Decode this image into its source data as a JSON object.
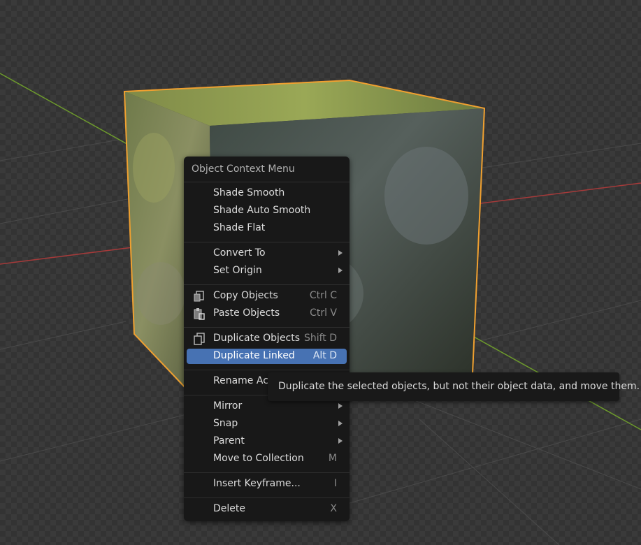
{
  "colors": {
    "menu_bg": "#181818",
    "highlight": "#4772b3",
    "selection_outline": "#f0a030",
    "x_axis": "#b33a3a",
    "y_axis": "#6d9a2c"
  },
  "context_menu": {
    "title": "Object Context Menu",
    "items": [
      {
        "label": "Shade Smooth",
        "shortcut": ""
      },
      {
        "label": "Shade Auto Smooth",
        "shortcut": ""
      },
      {
        "label": "Shade Flat",
        "shortcut": ""
      },
      {
        "label": "Convert To",
        "shortcut": "",
        "submenu": true
      },
      {
        "label": "Set Origin",
        "shortcut": "",
        "submenu": true
      },
      {
        "label": "Copy Objects",
        "shortcut": "Ctrl C",
        "icon": "copy-icon"
      },
      {
        "label": "Paste Objects",
        "shortcut": "Ctrl V",
        "icon": "paste-icon"
      },
      {
        "label": "Duplicate Objects",
        "shortcut": "Shift D",
        "icon": "duplicate-icon"
      },
      {
        "label": "Duplicate Linked",
        "shortcut": "Alt D",
        "highlighted": true
      },
      {
        "label": "Rename Active Item",
        "shortcut": ""
      },
      {
        "label": "Mirror",
        "shortcut": "",
        "submenu": true
      },
      {
        "label": "Snap",
        "shortcut": "",
        "submenu": true
      },
      {
        "label": "Parent",
        "shortcut": "",
        "submenu": true
      },
      {
        "label": "Move to Collection",
        "shortcut": "M"
      },
      {
        "label": "Insert Keyframe...",
        "shortcut": "I"
      },
      {
        "label": "Delete",
        "shortcut": "X"
      }
    ]
  },
  "tooltip": {
    "text": "Duplicate the selected objects, but not their object data, and move them."
  }
}
